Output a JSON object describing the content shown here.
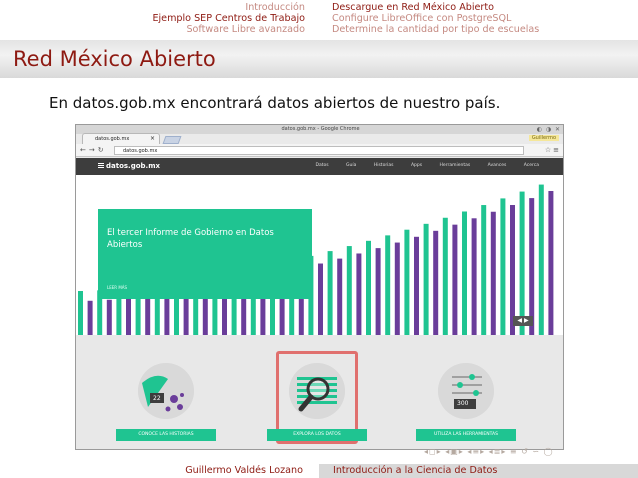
{
  "nav": {
    "sections": [
      "Introducción",
      "Ejemplo SEP Centros de Trabajo",
      "Software Libre avanzado"
    ],
    "subsections": [
      "Descargue en Red México Abierto",
      "Configure LibreOffice con PostgreSQL",
      "Determine la cantidad por tipo de escuelas"
    ]
  },
  "slide": {
    "title": "Red México Abierto",
    "intro": "En datos.gob.mx encontrará datos abiertos de nuestro país."
  },
  "browser": {
    "window_title": "datos.gob.mx - Google Chrome",
    "tab_label": "datos.gob.mx",
    "url": "datos.gob.mx",
    "user_badge": "Guillermo",
    "site": {
      "logo": "datos.gob.mx",
      "menu": [
        "Datos",
        "Guía",
        "Historias",
        "Apps",
        "Herramientas",
        "Avances",
        "Acerca"
      ],
      "hero_title": "El tercer Informe de Gobierno en Datos Abiertos",
      "hero_link": "LEER MÁS",
      "feature_buttons": [
        "CONOCE LAS HISTORIAS",
        "EXPLORA LOS DATOS",
        "UTILIZA LAS HERRAMIENTAS"
      ],
      "feature_badges": [
        "22",
        "300"
      ]
    }
  },
  "footer": {
    "author": "Guillermo Valdés Lozano",
    "title": "Introducción a la Ciencia de Datos"
  },
  "colors": {
    "accent": "#8e1a12",
    "green": "#1fc491",
    "purple": "#6a3d9a"
  }
}
